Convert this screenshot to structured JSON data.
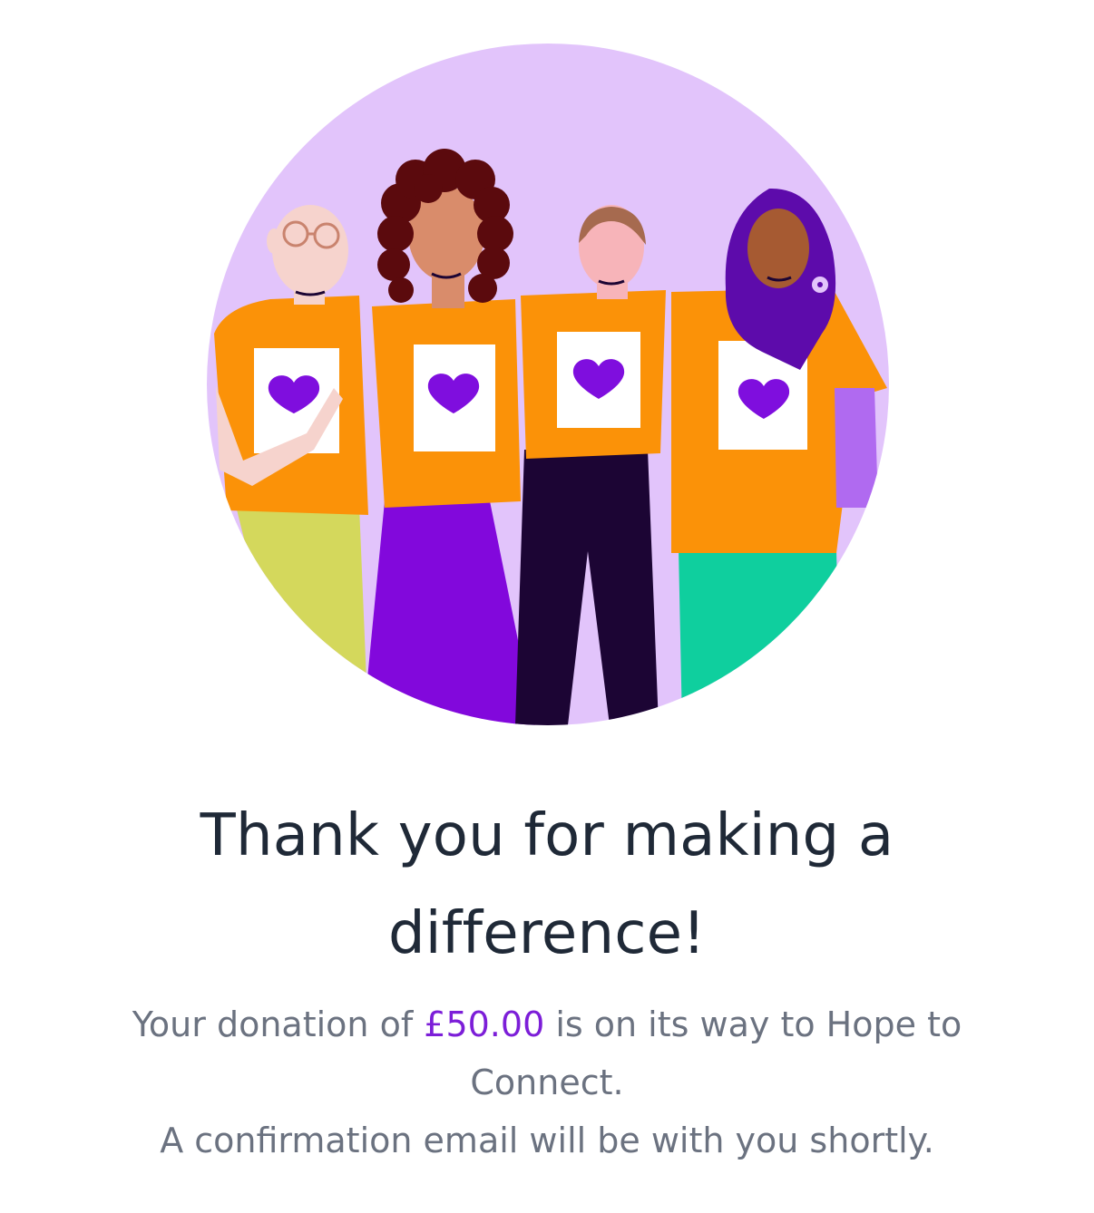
{
  "illustration": {
    "name": "volunteers-illustration",
    "colors": {
      "circle_bg": "#e2c4fb",
      "shirt": "#fb9208",
      "heart": "#7f0ede",
      "skirt": "#8208dc",
      "hijab": "#5d0bab",
      "trousers_dark": "#1c0534",
      "trousers_green": "#0fcf9e",
      "trousers_lime": "#d4d85c"
    }
  },
  "confirmation": {
    "title": "Thank you for making a difference!",
    "message_prefix": "Your donation of ",
    "amount": "£50.00",
    "message_suffix": " is on its way to Hope to Connect.",
    "email_note": "A confirmation email will be with you shortly."
  },
  "colors": {
    "accent": "#7c1ed8",
    "title": "#1f2937",
    "body": "#6b7280"
  }
}
